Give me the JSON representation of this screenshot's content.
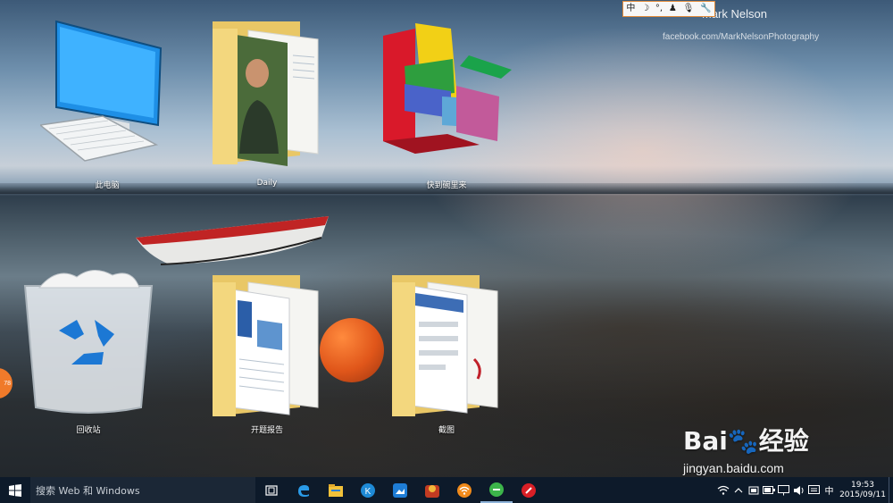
{
  "watermark": {
    "author": "Mark Nelson",
    "site": "facebook.com/MarkNelsonPhotography"
  },
  "ime_bar": {
    "items": [
      {
        "icon": "ime-chinese-icon",
        "glyph": "中"
      },
      {
        "icon": "moon-icon",
        "glyph": "☽"
      },
      {
        "icon": "punctuation-icon",
        "glyph": "°,"
      },
      {
        "icon": "user-icon",
        "glyph": "♟"
      },
      {
        "icon": "microphone-icon",
        "glyph": "🎙"
      },
      {
        "icon": "wrench-icon",
        "glyph": "🔧"
      }
    ]
  },
  "desktop": {
    "icons": {
      "this_pc": "此电脑",
      "daily": "Daily",
      "kuaidao": "快到碗里来",
      "recycle_bin": "回收站",
      "report": "开题报告",
      "screenshot": "截图"
    }
  },
  "side_badge": {
    "text": "78"
  },
  "baidu": {
    "logo_text": "Bai🐾经验",
    "url": "jingyan.baidu.com"
  },
  "taskbar": {
    "search_placeholder": "搜索 Web 和 Windows",
    "apps": [
      {
        "name": "task-view-icon",
        "active": false
      },
      {
        "name": "edge-icon",
        "active": false
      },
      {
        "name": "file-explorer-icon",
        "active": false
      },
      {
        "name": "k-app-icon",
        "active": false
      },
      {
        "name": "photo-viewer-icon",
        "active": false
      },
      {
        "name": "beaver-app-icon",
        "active": false
      },
      {
        "name": "wifi-app-icon",
        "active": false
      },
      {
        "name": "green-app-icon",
        "active": true
      },
      {
        "name": "red-app-icon",
        "active": false
      }
    ],
    "tray": {
      "input_lang": "中",
      "time": "19:53",
      "date": "2015/09/11"
    }
  },
  "colors": {
    "taskbar": "#0d1a2a",
    "accent_orange": "#f07a2a"
  }
}
